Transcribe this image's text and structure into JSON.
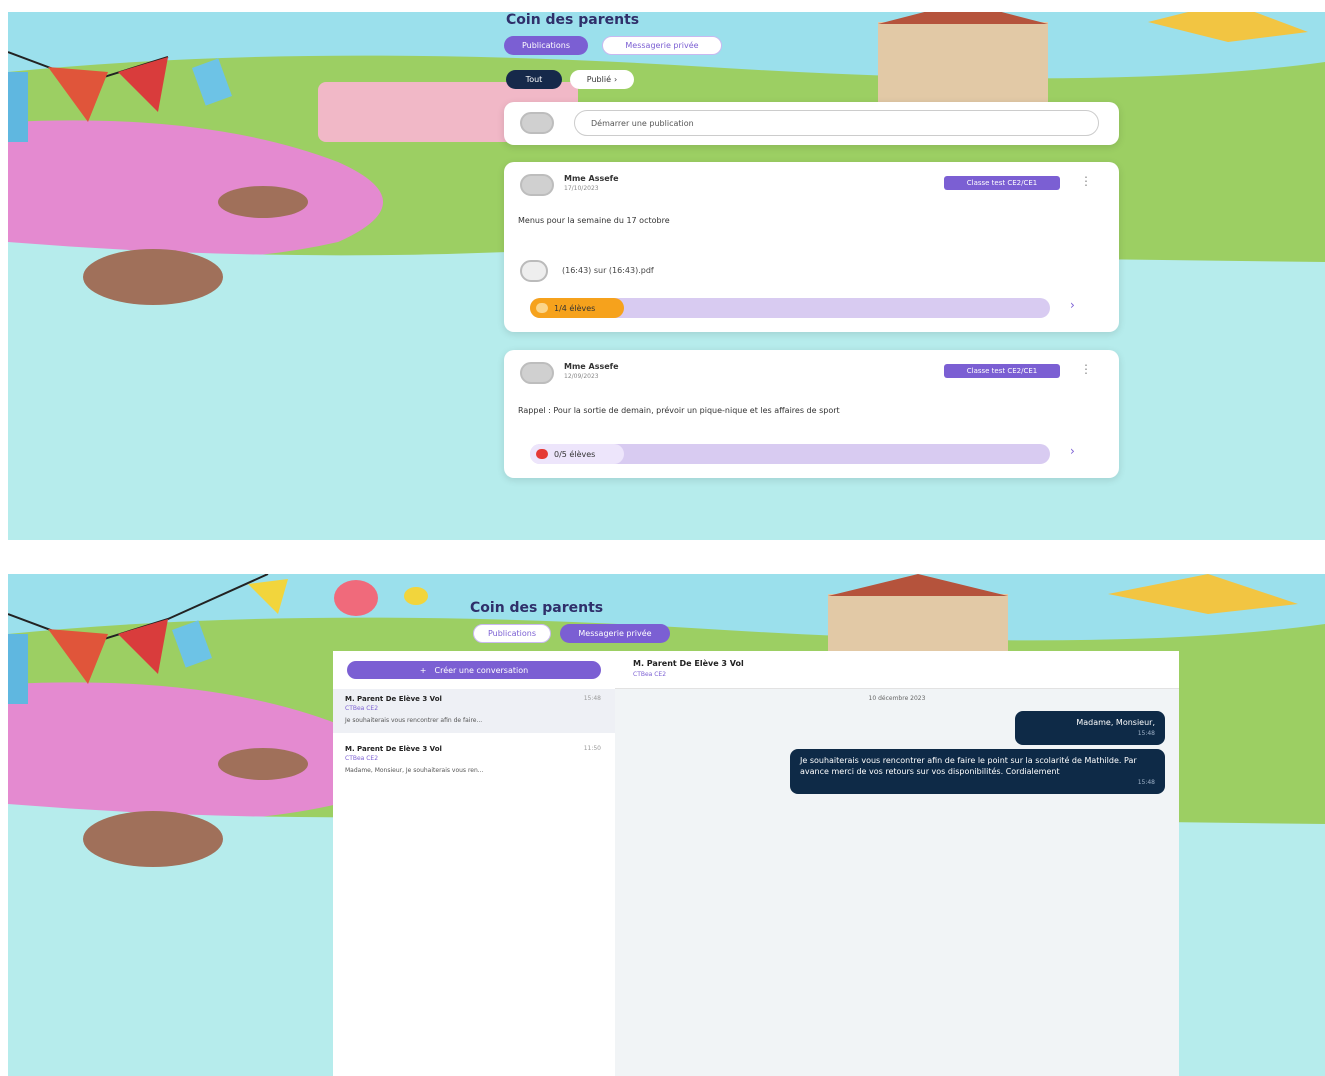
{
  "colors": {
    "sky": "#9be0ec",
    "grass": "#9ccf63",
    "flowers": "#e48ad0",
    "water": "#b6ecec",
    "accent": "#7b5fd3",
    "dark_tab": "#16294a",
    "bubble": "#0e2a47",
    "likes_orange": "#f6a21c",
    "likes_red": "#e53935"
  },
  "screen1": {
    "page_title": "Coin des parents",
    "tabs": {
      "publications": "Publications",
      "messagerie": "Messagerie privée"
    },
    "filters": {
      "tout": "Tout",
      "publie": "Publié"
    },
    "composer": {
      "placeholder": "Démarrer une publication"
    },
    "posts": [
      {
        "author": "Mme Assefe",
        "date": "17/10/2023",
        "class_tag": "Classe test CE2/CE1",
        "text": "Menus pour la semaine du 17 octobre",
        "attachment": "(16:43) sur (16:43).pdf",
        "likes_label": "1/4 élèves",
        "likes_color": "#f6a21c"
      },
      {
        "author": "Mme Assefe",
        "date": "12/09/2023",
        "class_tag": "Classe test CE2/CE1",
        "text": "Rappel : Pour la sortie de demain, prévoir un pique-nique et les affaires de sport",
        "likes_label": "0/5 élèves",
        "likes_color": "#e53935"
      }
    ]
  },
  "screen2": {
    "page_title": "Coin des parents",
    "tabs": {
      "publications": "Publications",
      "messagerie": "Messagerie privée"
    },
    "new_conversation": "Créer une conversation",
    "conversations": [
      {
        "name": "M. Parent De Elève 3 Vol",
        "class": "CTBea CE2",
        "time": "15:48",
        "preview": "Je souhaiterais vous rencontrer afin de faire..."
      },
      {
        "name": "M. Parent De Elève 3 Vol",
        "class": "CTBea CE2",
        "time": "11:50",
        "preview": "Madame, Monsieur, Je souhaiterais vous ren..."
      }
    ],
    "chat": {
      "title": "M. Parent De Elève 3 Vol",
      "subtitle": "CTBea CE2",
      "date_separator": "10 décembre 2023",
      "messages": [
        {
          "text": "Madame, Monsieur,",
          "time": "15:48"
        },
        {
          "text": "Je souhaiterais vous rencontrer afin de faire le point sur la scolarité de Mathilde. Par avance merci de vos retours sur vos disponibilités. Cordialement",
          "time": "15:48"
        }
      ]
    }
  }
}
